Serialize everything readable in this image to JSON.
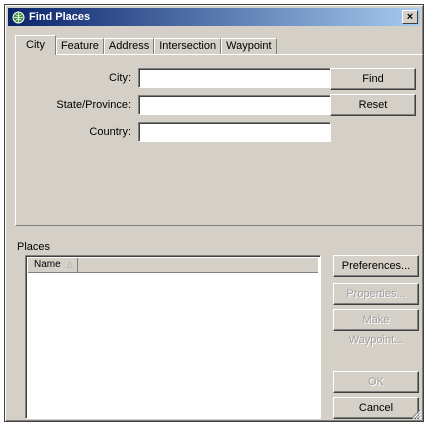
{
  "window": {
    "title": "Find Places",
    "close_glyph": "×"
  },
  "tabs": [
    "City",
    "Feature",
    "Address",
    "Intersection",
    "Waypoint"
  ],
  "form": {
    "city_label": "City:",
    "state_label": "State/Province:",
    "country_label": "Country:",
    "city_value": "",
    "state_value": "",
    "country_value": ""
  },
  "buttons": {
    "find": "Find",
    "reset": "Reset",
    "preferences": "Preferences...",
    "properties": "Properties...",
    "make_waypoint": "Make Waypoint...",
    "ok": "OK",
    "cancel": "Cancel"
  },
  "places": {
    "label": "Places",
    "columns": [
      "Name"
    ],
    "sort_glyph": "△",
    "rows": []
  },
  "icons": {
    "app": "globe-icon",
    "sort": "sort-ascending-icon",
    "grip": "resize-grip-icon"
  }
}
